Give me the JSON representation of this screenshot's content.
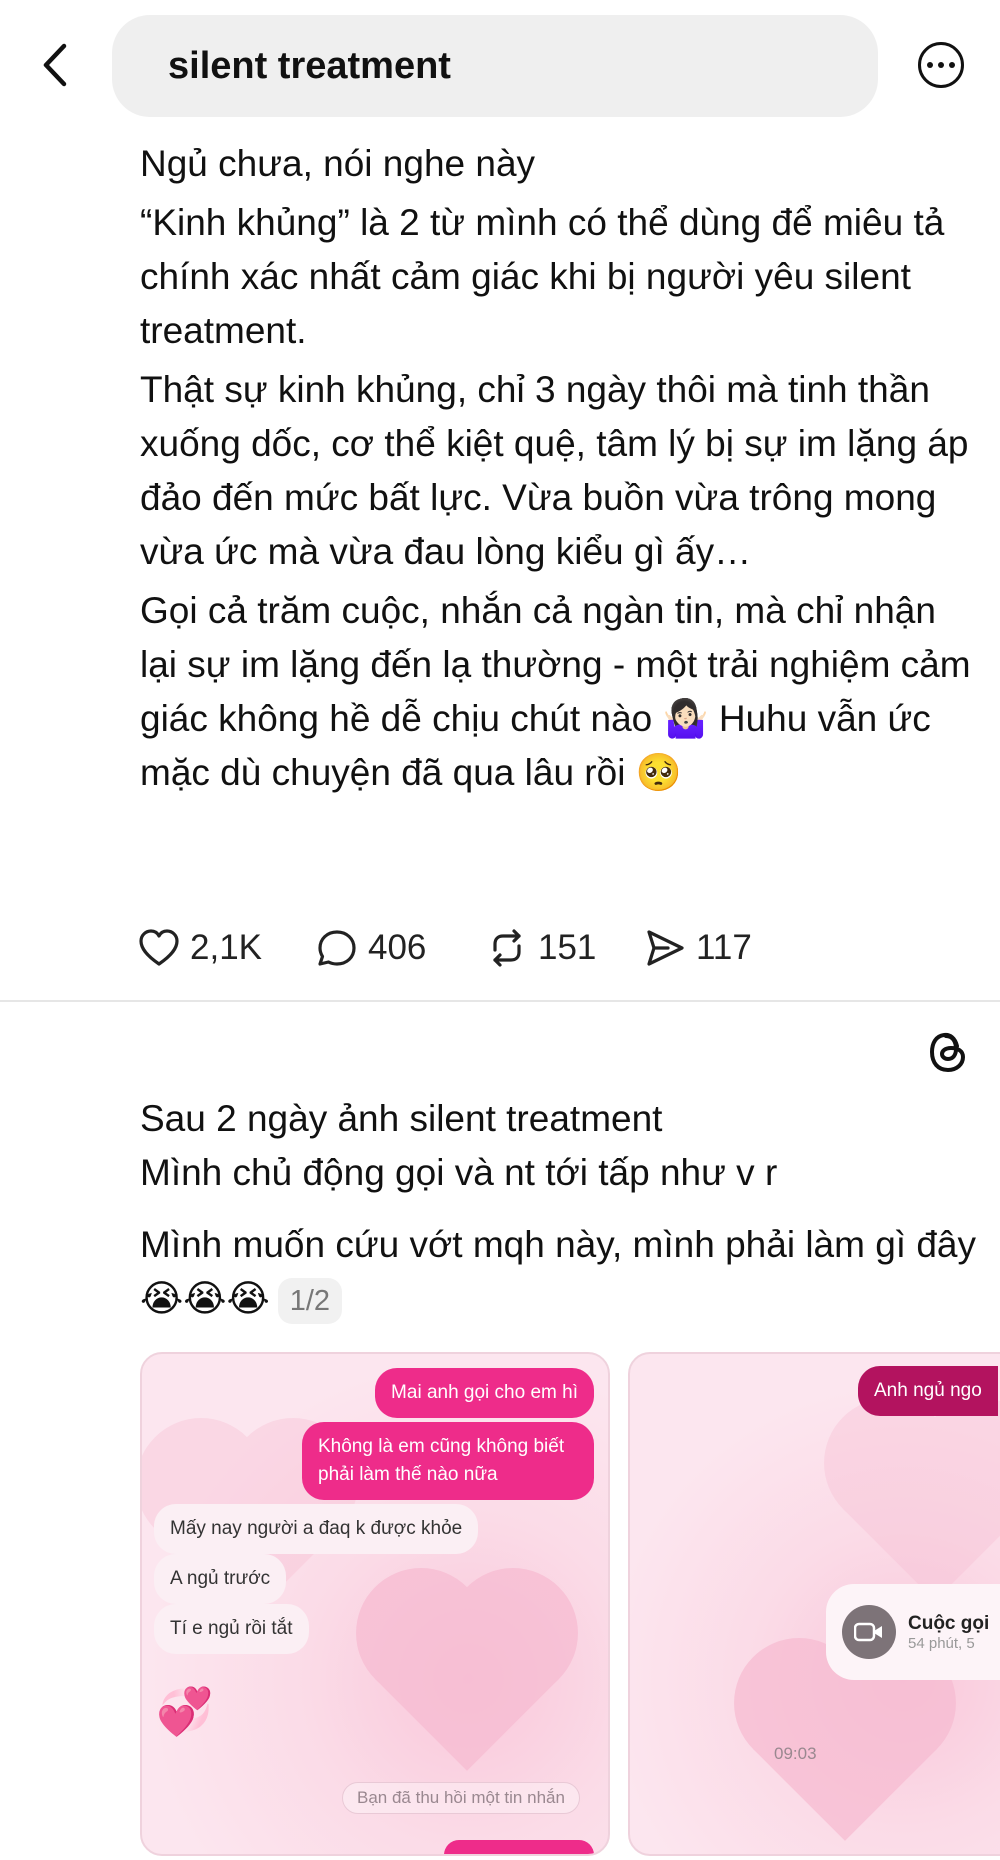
{
  "header": {
    "search_query": "silent treatment",
    "back_icon": "chevron-left-icon",
    "more_icon": "ellipsis-circle-icon"
  },
  "post1": {
    "paragraphs": [
      "Ngủ chưa, nói nghe này",
      "“Kinh khủng” là 2 từ mình có thể dùng để miêu tả chính xác nhất cảm giác khi bị người yêu silent treatment.",
      "Thật sự kinh khủng, chỉ 3 ngày thôi mà tinh thần xuống dốc, cơ thể kiệt quệ, tâm lý bị sự im lặng áp đảo đến mức bất lực. Vừa buồn vừa trông mong vừa ức mà vừa đau lòng kiểu gì ấy…",
      "Gọi cả trăm cuộc, nhắn cả ngàn tin, mà chỉ nhận lại sự im lặng đến lạ thường - một trải nghiệm cảm giác không hề dễ chịu chút nào 🤷🏻‍♀️ Huhu vẫn ức mặc dù chuyện đã qua lâu rồi 🥺"
    ],
    "likes": "2,1K",
    "comments": "406",
    "reposts": "151",
    "shares": "117"
  },
  "post2": {
    "line1": "Sau 2 ngày ảnh silent treatment",
    "line2": "Mình chủ động gọi và nt tới tấp như v r",
    "line3": "Mình muốn cứu vớt mqh này, mình phải làm gì đây 😭😭😭",
    "page_indicator": "1/2",
    "brand_icon": "threads-icon"
  },
  "screenshot1": {
    "messages": [
      {
        "dir": "out",
        "text": "Mai anh gọi cho em hì"
      },
      {
        "dir": "out",
        "text": "Không là em cũng không biết phải làm thế nào nữa"
      },
      {
        "dir": "in",
        "text": "Mấy nay người a đaq k được khỏe"
      },
      {
        "dir": "in",
        "text": "A ngủ trước"
      },
      {
        "dir": "in",
        "text": "Tí e ngủ rồi tắt"
      }
    ],
    "sticker": "💞",
    "system_note": "Bạn đã thu hồi một tin nhắn"
  },
  "screenshot2": {
    "top_message": "Anh ngủ ngo",
    "call_title": "Cuộc gọi",
    "call_sub": "54 phút, 5",
    "timestamp": "09:03"
  },
  "colors": {
    "accent_pink": "#ee2c8a",
    "text": "#111111",
    "muted": "#777777"
  }
}
